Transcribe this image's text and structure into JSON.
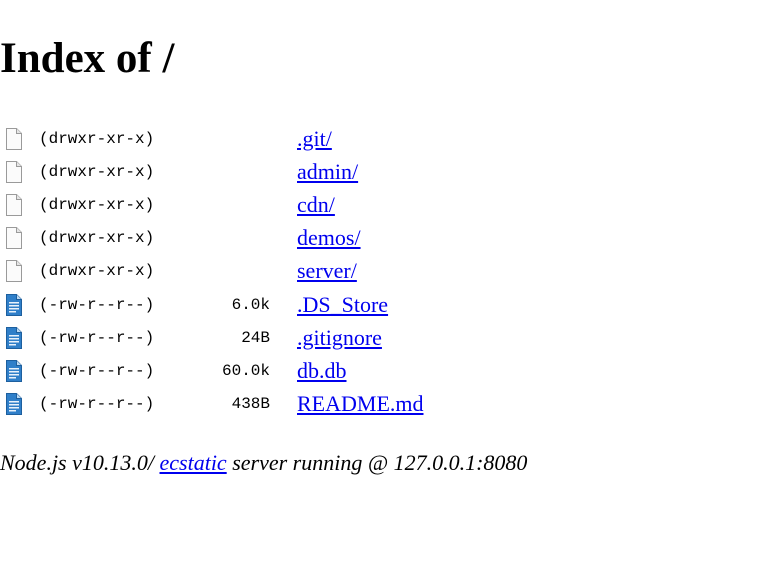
{
  "page": {
    "title": "Index of /"
  },
  "colors": {
    "link": "#0000ee",
    "text": "#000000",
    "background": "#ffffff",
    "file_icon_blue": "#2f7fc9"
  },
  "entries": [
    {
      "perms": "(drwxr-xr-x)",
      "size": "",
      "name": ".git/",
      "icon": "blank-document-icon"
    },
    {
      "perms": "(drwxr-xr-x)",
      "size": "",
      "name": "admin/",
      "icon": "blank-document-icon"
    },
    {
      "perms": "(drwxr-xr-x)",
      "size": "",
      "name": "cdn/",
      "icon": "blank-document-icon"
    },
    {
      "perms": "(drwxr-xr-x)",
      "size": "",
      "name": "demos/",
      "icon": "blank-document-icon"
    },
    {
      "perms": "(drwxr-xr-x)",
      "size": "",
      "name": "server/",
      "icon": "blank-document-icon"
    },
    {
      "perms": "(-rw-r--r--)",
      "size": "6.0k",
      "name": ".DS_Store",
      "icon": "text-document-icon"
    },
    {
      "perms": "(-rw-r--r--)",
      "size": "24B",
      "name": ".gitignore",
      "icon": "text-document-icon"
    },
    {
      "perms": "(-rw-r--r--)",
      "size": "60.0k",
      "name": "db.db",
      "icon": "text-document-icon"
    },
    {
      "perms": "(-rw-r--r--)",
      "size": "438B",
      "name": "README.md",
      "icon": "text-document-icon"
    }
  ],
  "footer": {
    "prefix": "Node.js v10.13.0/ ",
    "link_text": "ecstatic",
    "suffix": " server running @ 127.0.0.1:8080"
  }
}
